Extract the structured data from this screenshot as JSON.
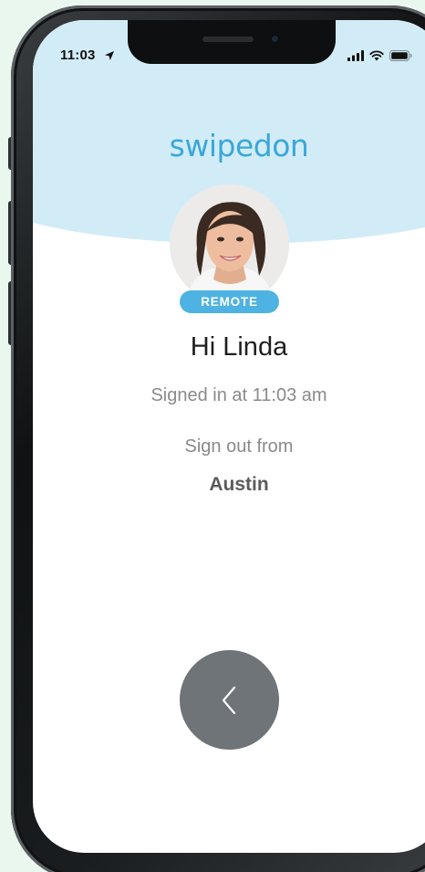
{
  "status_bar": {
    "time": "11:03",
    "icons": [
      "location-arrow-icon",
      "cellular-signal-icon",
      "wifi-icon",
      "battery-icon"
    ]
  },
  "app": {
    "brand": "swipedon"
  },
  "profile": {
    "badge": "REMOTE",
    "greeting": "Hi Linda",
    "signed_in": "Signed in at 11:03 am",
    "sign_out_prompt": "Sign out from",
    "location": "Austin"
  },
  "actions": {
    "back_icon": "chevron-left-icon"
  },
  "colors": {
    "accent": "#3aa7d8",
    "badge": "#4eb3e2",
    "header_background": "#d2ecf7",
    "back_button": "#6e7478",
    "page_background": "#eaf7ef"
  }
}
